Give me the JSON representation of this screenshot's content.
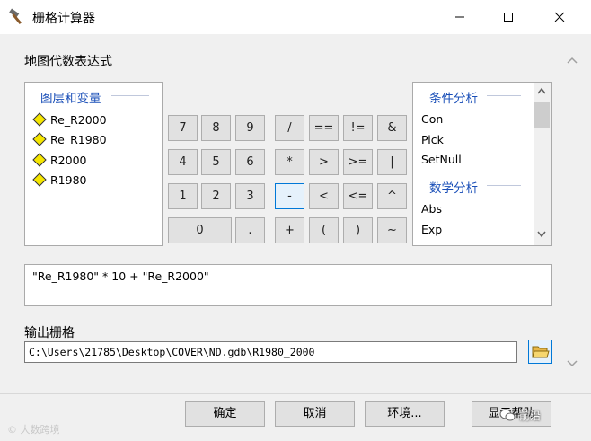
{
  "window": {
    "title": "栅格计算器",
    "app_icon": "hammer-icon",
    "controls": [
      "minimize-icon",
      "maximize-icon",
      "close-icon"
    ]
  },
  "expression_section": {
    "label": "地图代数表达式"
  },
  "layers_panel": {
    "heading": "图层和变量",
    "items": [
      "Re_R2000",
      "Re_R1980",
      "R2000",
      "R1980"
    ],
    "item_icon": "raster-layer-diamond-icon",
    "icon_color": "#f5e600"
  },
  "calculator": {
    "buttons": [
      "7",
      "8",
      "9",
      "/",
      "==",
      "!=",
      "&",
      "4",
      "5",
      "6",
      "*",
      ">",
      ">=",
      "|",
      "1",
      "2",
      "3",
      "-",
      "<",
      "<=",
      "^",
      "0",
      ".",
      "+",
      "(",
      ")",
      "~"
    ],
    "selected": "-"
  },
  "functions_panel": {
    "groups": [
      {
        "heading": "条件分析",
        "items": [
          "Con",
          "Pick",
          "SetNull"
        ]
      },
      {
        "heading": "数学分析",
        "items": [
          "Abs",
          "Exp"
        ]
      }
    ]
  },
  "expression": {
    "value": "\"Re_R1980\" * 10 + \"Re_R2000\""
  },
  "output": {
    "label": "输出栅格",
    "value": "C:\\Users\\21785\\Desktop\\COVER\\ND.gdb\\R1980_2000",
    "browse_icon": "open-folder-icon"
  },
  "footer": {
    "ok": "确定",
    "cancel": "取消",
    "environments": "环境...",
    "show_help": "显示帮助"
  },
  "watermarks": {
    "left": "© 大数跨境",
    "right": "前沿"
  },
  "colors": {
    "heading_blue": "#1a4fb8",
    "accent": "#0078d7"
  }
}
